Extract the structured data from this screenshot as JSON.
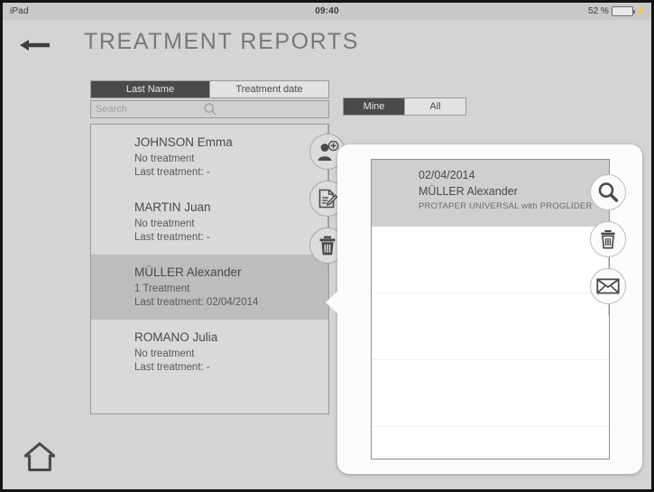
{
  "statusbar": {
    "device": "iPad",
    "time": "09:40",
    "battery_percent": "52 %",
    "battery_level": 52,
    "battery_icon": "battery-icon",
    "charging_icon": "lightning-bolt-icon"
  },
  "header": {
    "title": "TREATMENT REPORTS",
    "back_icon": "back-arrow-icon"
  },
  "left_panel": {
    "sort_tabs": [
      {
        "label": "Last Name",
        "active": true
      },
      {
        "label": "Treatment date",
        "active": false
      }
    ],
    "search": {
      "placeholder": "Search",
      "value": "",
      "icon": "search-icon"
    },
    "patients": [
      {
        "name": "JOHNSON Emma",
        "treatment_count": "No treatment",
        "last_treatment": "Last treatment: -",
        "selected": false
      },
      {
        "name": "MARTIN Juan",
        "treatment_count": "No treatment",
        "last_treatment": "Last treatment: -",
        "selected": false
      },
      {
        "name": "MÜLLER Alexander",
        "treatment_count": "1 Treatment",
        "last_treatment": "Last treatment: 02/04/2014",
        "selected": true
      },
      {
        "name": "ROMANO Julia",
        "treatment_count": "No treatment",
        "last_treatment": "Last treatment: -",
        "selected": false
      }
    ]
  },
  "left_actions": [
    {
      "icon": "add-person-icon",
      "name": "add-patient-button"
    },
    {
      "icon": "edit-document-icon",
      "name": "edit-patient-button"
    },
    {
      "icon": "trash-icon",
      "name": "delete-patient-button"
    }
  ],
  "owner_filter": {
    "tabs": [
      {
        "label": "Mine",
        "active": true
      },
      {
        "label": "All",
        "active": false
      }
    ]
  },
  "popover": {
    "reports": [
      {
        "date": "02/04/2014",
        "patient": "MÜLLER Alexander",
        "description": "PROTAPER UNIVERSAL with PROGLIDER",
        "selected": true
      },
      {
        "date": "",
        "patient": "",
        "description": "",
        "selected": false
      },
      {
        "date": "",
        "patient": "",
        "description": "",
        "selected": false
      },
      {
        "date": "",
        "patient": "",
        "description": "",
        "selected": false
      }
    ]
  },
  "right_actions": [
    {
      "icon": "search-icon",
      "name": "view-report-button"
    },
    {
      "icon": "trash-icon",
      "name": "delete-report-button"
    },
    {
      "icon": "mail-icon",
      "name": "email-report-button"
    }
  ],
  "footer": {
    "home_icon": "home-icon"
  },
  "colors": {
    "screen_background": "#d4d4d4",
    "statusbar_background": "#c9c9c9",
    "accent_dark": "#4a4a4a",
    "selected_row": "#bdbdbd",
    "battery_green": "#52c95a",
    "popover_background": "#fcfcfc"
  }
}
